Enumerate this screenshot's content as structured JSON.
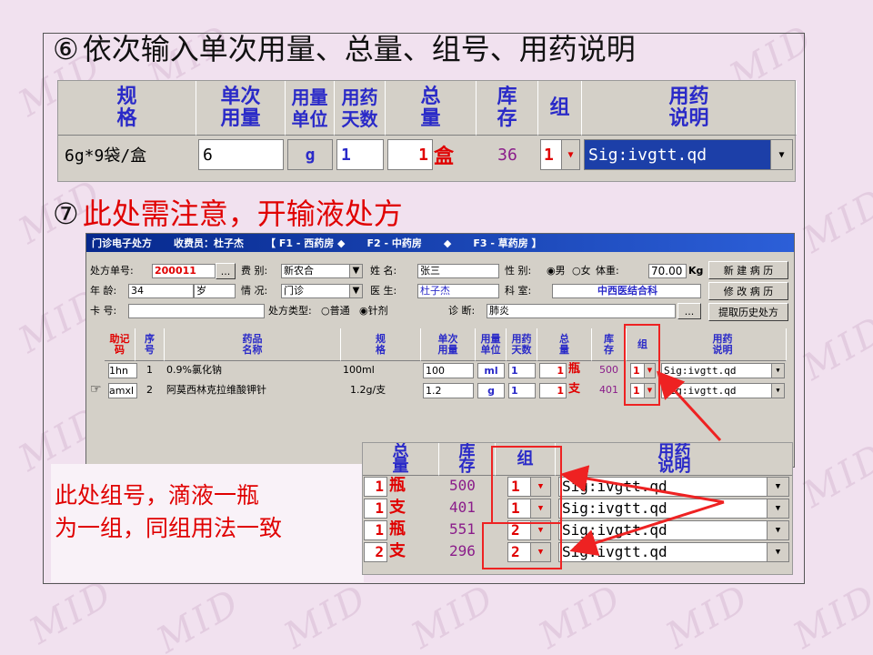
{
  "watermark": "MID",
  "headings": {
    "step6": {
      "num": "⑥",
      "text": "依次输入单次用量、总量、组号、用药说明"
    },
    "step7": {
      "num": "⑦",
      "text": "此处需注意，开输液处方"
    }
  },
  "top_grid": {
    "headers": [
      "规\n格",
      "单次\n用量",
      "用量\n单位",
      "用药\n天数",
      "总\n量",
      "库\n存",
      "组",
      "用药\n说明"
    ],
    "row": {
      "spec": "6g*9袋/盒",
      "dose": "6",
      "unit": "g",
      "days": "1",
      "total": "1",
      "total_unit": "盒",
      "stock": "36",
      "group": "1",
      "usage": "Sig:ivgtt.qd"
    }
  },
  "window": {
    "title": "门诊电子处方",
    "cashier": "收费员：杜子杰",
    "tabs": [
      "【 F1 - 西药房 ◆",
      "F2 - 中药房",
      "◆",
      "F3 - 草药房 】"
    ],
    "labels": {
      "rx_no": "处方单号:",
      "fee": "费 别:",
      "name": "姓 名:",
      "gender": "性 别:",
      "male": "男",
      "female": "女",
      "weight": "体重:",
      "weight_unit": "Kg",
      "age": "年 龄:",
      "status": "情 况:",
      "doctor": "医 生:",
      "dept": "科 室:",
      "card": "卡 号:",
      "rx_type": "处方类型:",
      "normal": "普通",
      "injection": "针剂",
      "diagnosis": "诊 断:"
    },
    "values": {
      "rx_no": "200011",
      "fee": "新农合",
      "name": "张三",
      "weight": "70.00",
      "age": "34",
      "age_unit": "岁",
      "status": "门诊",
      "doctor": "杜子杰",
      "dept": "中西医结合科",
      "card": "",
      "diagnosis": "肺炎"
    },
    "ellipsis": "...",
    "buttons": [
      "新 建 病 历",
      "修 改 病 历",
      "提取历史处方"
    ],
    "grid_headers": [
      "助记\n码",
      "序\n号",
      "药品\n名称",
      "规\n格",
      "单次\n用量",
      "用量\n单位",
      "用药\n天数",
      "总\n量",
      "库\n存",
      "组",
      "用药\n说明"
    ],
    "rows": [
      {
        "code": "1hn",
        "no": "1",
        "name": "0.9%氯化钠",
        "spec": "100ml",
        "dose": "100",
        "unit": "ml",
        "days": "1",
        "total": "1",
        "total_unit": "瓶",
        "stock": "500",
        "group": "1",
        "usage": "Sig:ivgtt.qd"
      },
      {
        "code": "amxl",
        "no": "2",
        "name": "阿莫西林克拉维酸钾针",
        "spec": "1.2g/支",
        "dose": "1.2",
        "unit": "g",
        "days": "1",
        "total": "1",
        "total_unit": "支",
        "stock": "401",
        "group": "1",
        "usage": "Sig:ivgtt.qd"
      }
    ]
  },
  "zoom_grid": {
    "headers": [
      "总\n量",
      "库\n存",
      "组",
      "用药\n说明"
    ],
    "rows": [
      {
        "total": "1",
        "unit": "瓶",
        "stock": "500",
        "group": "1",
        "usage": "Sig:ivgtt.qd"
      },
      {
        "total": "1",
        "unit": "支",
        "stock": "401",
        "group": "1",
        "usage": "Sig:ivgtt.qd"
      },
      {
        "total": "1",
        "unit": "瓶",
        "stock": "551",
        "group": "2",
        "usage": "Sig:ivgtt.qd"
      },
      {
        "total": "2",
        "unit": "支",
        "stock": "296",
        "group": "2",
        "usage": "Sig:ivgtt.qd"
      }
    ]
  },
  "callout": {
    "line1": "此处组号，滴液一瓶",
    "line2": "为一组，同组用法一致"
  },
  "colors": {
    "background": "#f1e1ef",
    "accent_red": "#e00000",
    "header_blue": "#2a2ac8",
    "panel_gray": "#d4d0c8",
    "stock_purple": "#8a1c8a"
  }
}
